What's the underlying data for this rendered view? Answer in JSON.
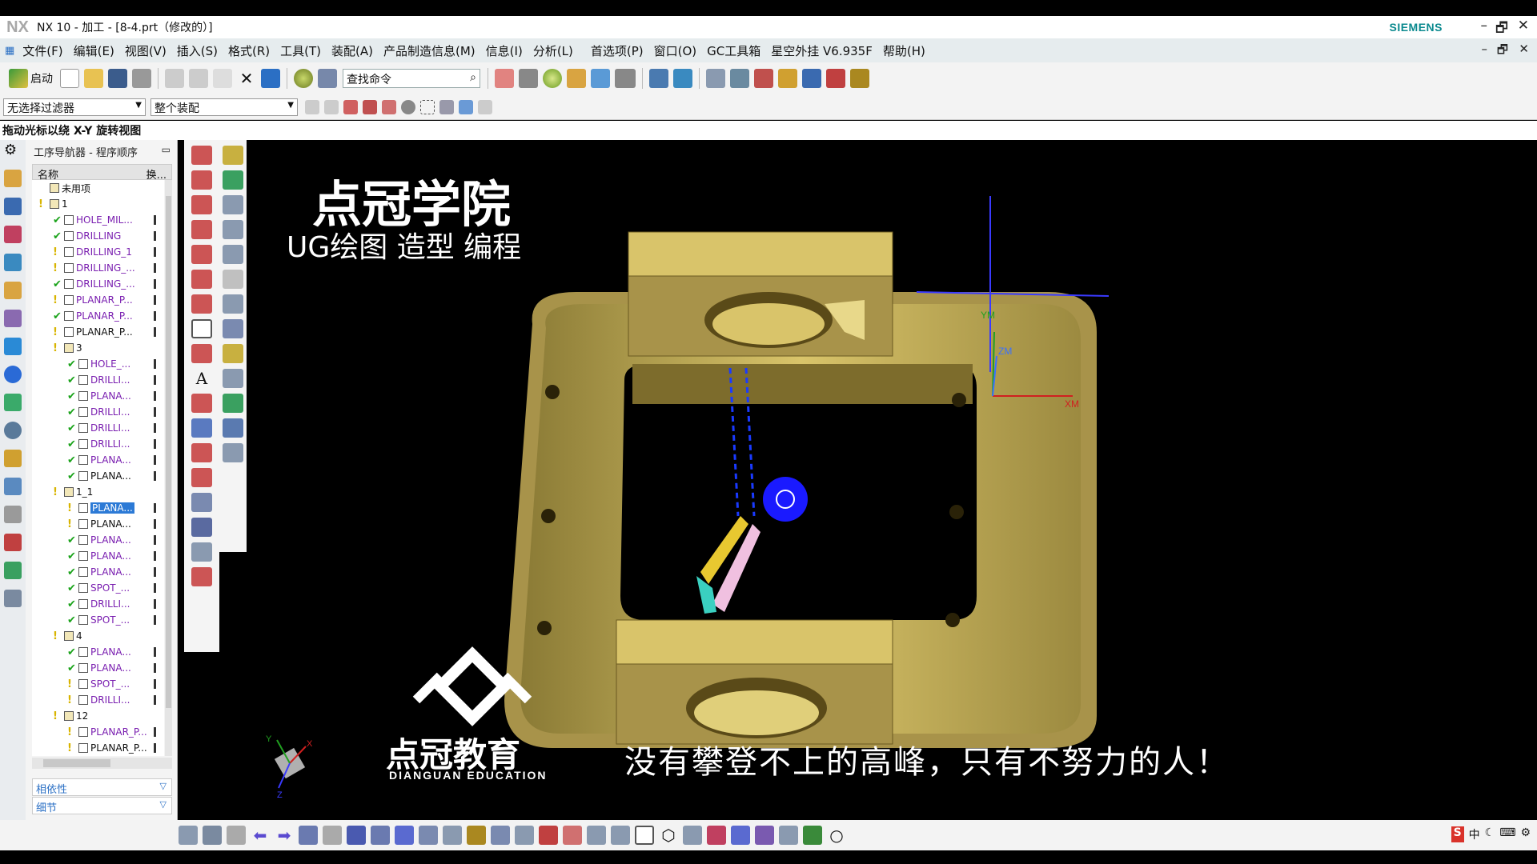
{
  "titlebar": {
    "logo": "NX",
    "title": "NX 10 - 加工 - [8-4.prt（修改的）]",
    "brand": "SIEMENS",
    "minimize": "–",
    "restore": "🗗",
    "close": "✕"
  },
  "menubar": {
    "items": [
      "文件(F)",
      "编辑(E)",
      "视图(V)",
      "插入(S)",
      "格式(R)",
      "工具(T)",
      "装配(A)",
      "产品制造信息(M)",
      "信息(I)",
      "分析(L)",
      "首选项(P)",
      "窗口(O)",
      "GC工具箱",
      "星空外挂 V6.935F",
      "帮助(H)"
    ]
  },
  "toolbar": {
    "start_label": "启动",
    "search_placeholder": "查找命令"
  },
  "filters": {
    "selection_filter": "无选择过滤器",
    "assembly_scope": "整个装配"
  },
  "status": {
    "cue": "拖动光标以绕 X-Y 旋转视图"
  },
  "navigator": {
    "title": "工序导航器 - 程序顺序",
    "col_name": "名称",
    "col_change": "换...",
    "rows": [
      {
        "depth": 0,
        "status": "",
        "type": "group",
        "label": "未用项"
      },
      {
        "depth": 0,
        "status": "warn",
        "type": "group",
        "label": "1"
      },
      {
        "depth": 1,
        "status": "ok",
        "type": "op",
        "label": "HOLE_MIL..."
      },
      {
        "depth": 1,
        "status": "ok",
        "type": "op",
        "label": "DRILLING"
      },
      {
        "depth": 1,
        "status": "warn",
        "type": "op",
        "label": "DRILLING_1"
      },
      {
        "depth": 1,
        "status": "warn",
        "type": "op",
        "label": "DRILLING_..."
      },
      {
        "depth": 1,
        "status": "ok",
        "type": "op",
        "label": "DRILLING_..."
      },
      {
        "depth": 1,
        "status": "warn",
        "type": "op",
        "label": "PLANAR_P..."
      },
      {
        "depth": 1,
        "status": "ok",
        "type": "op",
        "label": "PLANAR_P..."
      },
      {
        "depth": 1,
        "status": "warn",
        "type": "op",
        "label": "PLANAR_P...",
        "plain": true
      },
      {
        "depth": 1,
        "status": "warn",
        "type": "group",
        "label": "3"
      },
      {
        "depth": 2,
        "status": "ok",
        "type": "op",
        "label": "HOLE_..."
      },
      {
        "depth": 2,
        "status": "ok",
        "type": "op",
        "label": "DRILLI..."
      },
      {
        "depth": 2,
        "status": "ok",
        "type": "op",
        "label": "PLANA..."
      },
      {
        "depth": 2,
        "status": "ok",
        "type": "op",
        "label": "DRILLI..."
      },
      {
        "depth": 2,
        "status": "ok",
        "type": "op",
        "label": "DRILLI..."
      },
      {
        "depth": 2,
        "status": "ok",
        "type": "op",
        "label": "DRILLI..."
      },
      {
        "depth": 2,
        "status": "ok",
        "type": "op",
        "label": "PLANA..."
      },
      {
        "depth": 2,
        "status": "ok",
        "type": "op",
        "label": "PLANA...",
        "plain": true
      },
      {
        "depth": 1,
        "status": "warn",
        "type": "group",
        "label": "1_1"
      },
      {
        "depth": 2,
        "status": "warn",
        "type": "op",
        "label": "PLANA...",
        "selected": true
      },
      {
        "depth": 2,
        "status": "warn",
        "type": "op",
        "label": "PLANA...",
        "plain": true
      },
      {
        "depth": 2,
        "status": "ok",
        "type": "op",
        "label": "PLANA..."
      },
      {
        "depth": 2,
        "status": "ok",
        "type": "op",
        "label": "PLANA..."
      },
      {
        "depth": 2,
        "status": "ok",
        "type": "op",
        "label": "PLANA..."
      },
      {
        "depth": 2,
        "status": "ok",
        "type": "op",
        "label": "SPOT_..."
      },
      {
        "depth": 2,
        "status": "ok",
        "type": "op",
        "label": "DRILLI..."
      },
      {
        "depth": 2,
        "status": "ok",
        "type": "op",
        "label": "SPOT_..."
      },
      {
        "depth": 1,
        "status": "warn",
        "type": "group",
        "label": "4"
      },
      {
        "depth": 2,
        "status": "ok",
        "type": "op",
        "label": "PLANA..."
      },
      {
        "depth": 2,
        "status": "ok",
        "type": "op",
        "label": "PLANA..."
      },
      {
        "depth": 2,
        "status": "warn",
        "type": "op",
        "label": "SPOT_..."
      },
      {
        "depth": 2,
        "status": "warn",
        "type": "op",
        "label": "DRILLI..."
      },
      {
        "depth": 1,
        "status": "warn",
        "type": "group",
        "label": "12"
      },
      {
        "depth": 2,
        "status": "warn",
        "type": "op",
        "label": "PLANAR_P..."
      },
      {
        "depth": 2,
        "status": "warn",
        "type": "op",
        "label": "PLANAR_P...",
        "plain": true
      }
    ],
    "dependencies_label": "相依性",
    "details_label": "细节"
  },
  "viewport": {
    "watermark_title": "点冠学院",
    "watermark_sub": "UG绘图 造型 编程",
    "brand_cn": "点冠教育",
    "brand_en": "DIANGUAN EDUCATION",
    "slogan": "没有攀登不上的高峰，只有不努力的人！",
    "axis_xm": "XM",
    "axis_ym": "YM",
    "axis_zm": "ZM",
    "triad_x": "X",
    "triad_y": "Y",
    "triad_z": "Z"
  },
  "colors": {
    "part": "#d9c46a",
    "selection": "#2c7ad6",
    "menu_bg": "#e6ecee",
    "brand": "#0b8a8f"
  }
}
